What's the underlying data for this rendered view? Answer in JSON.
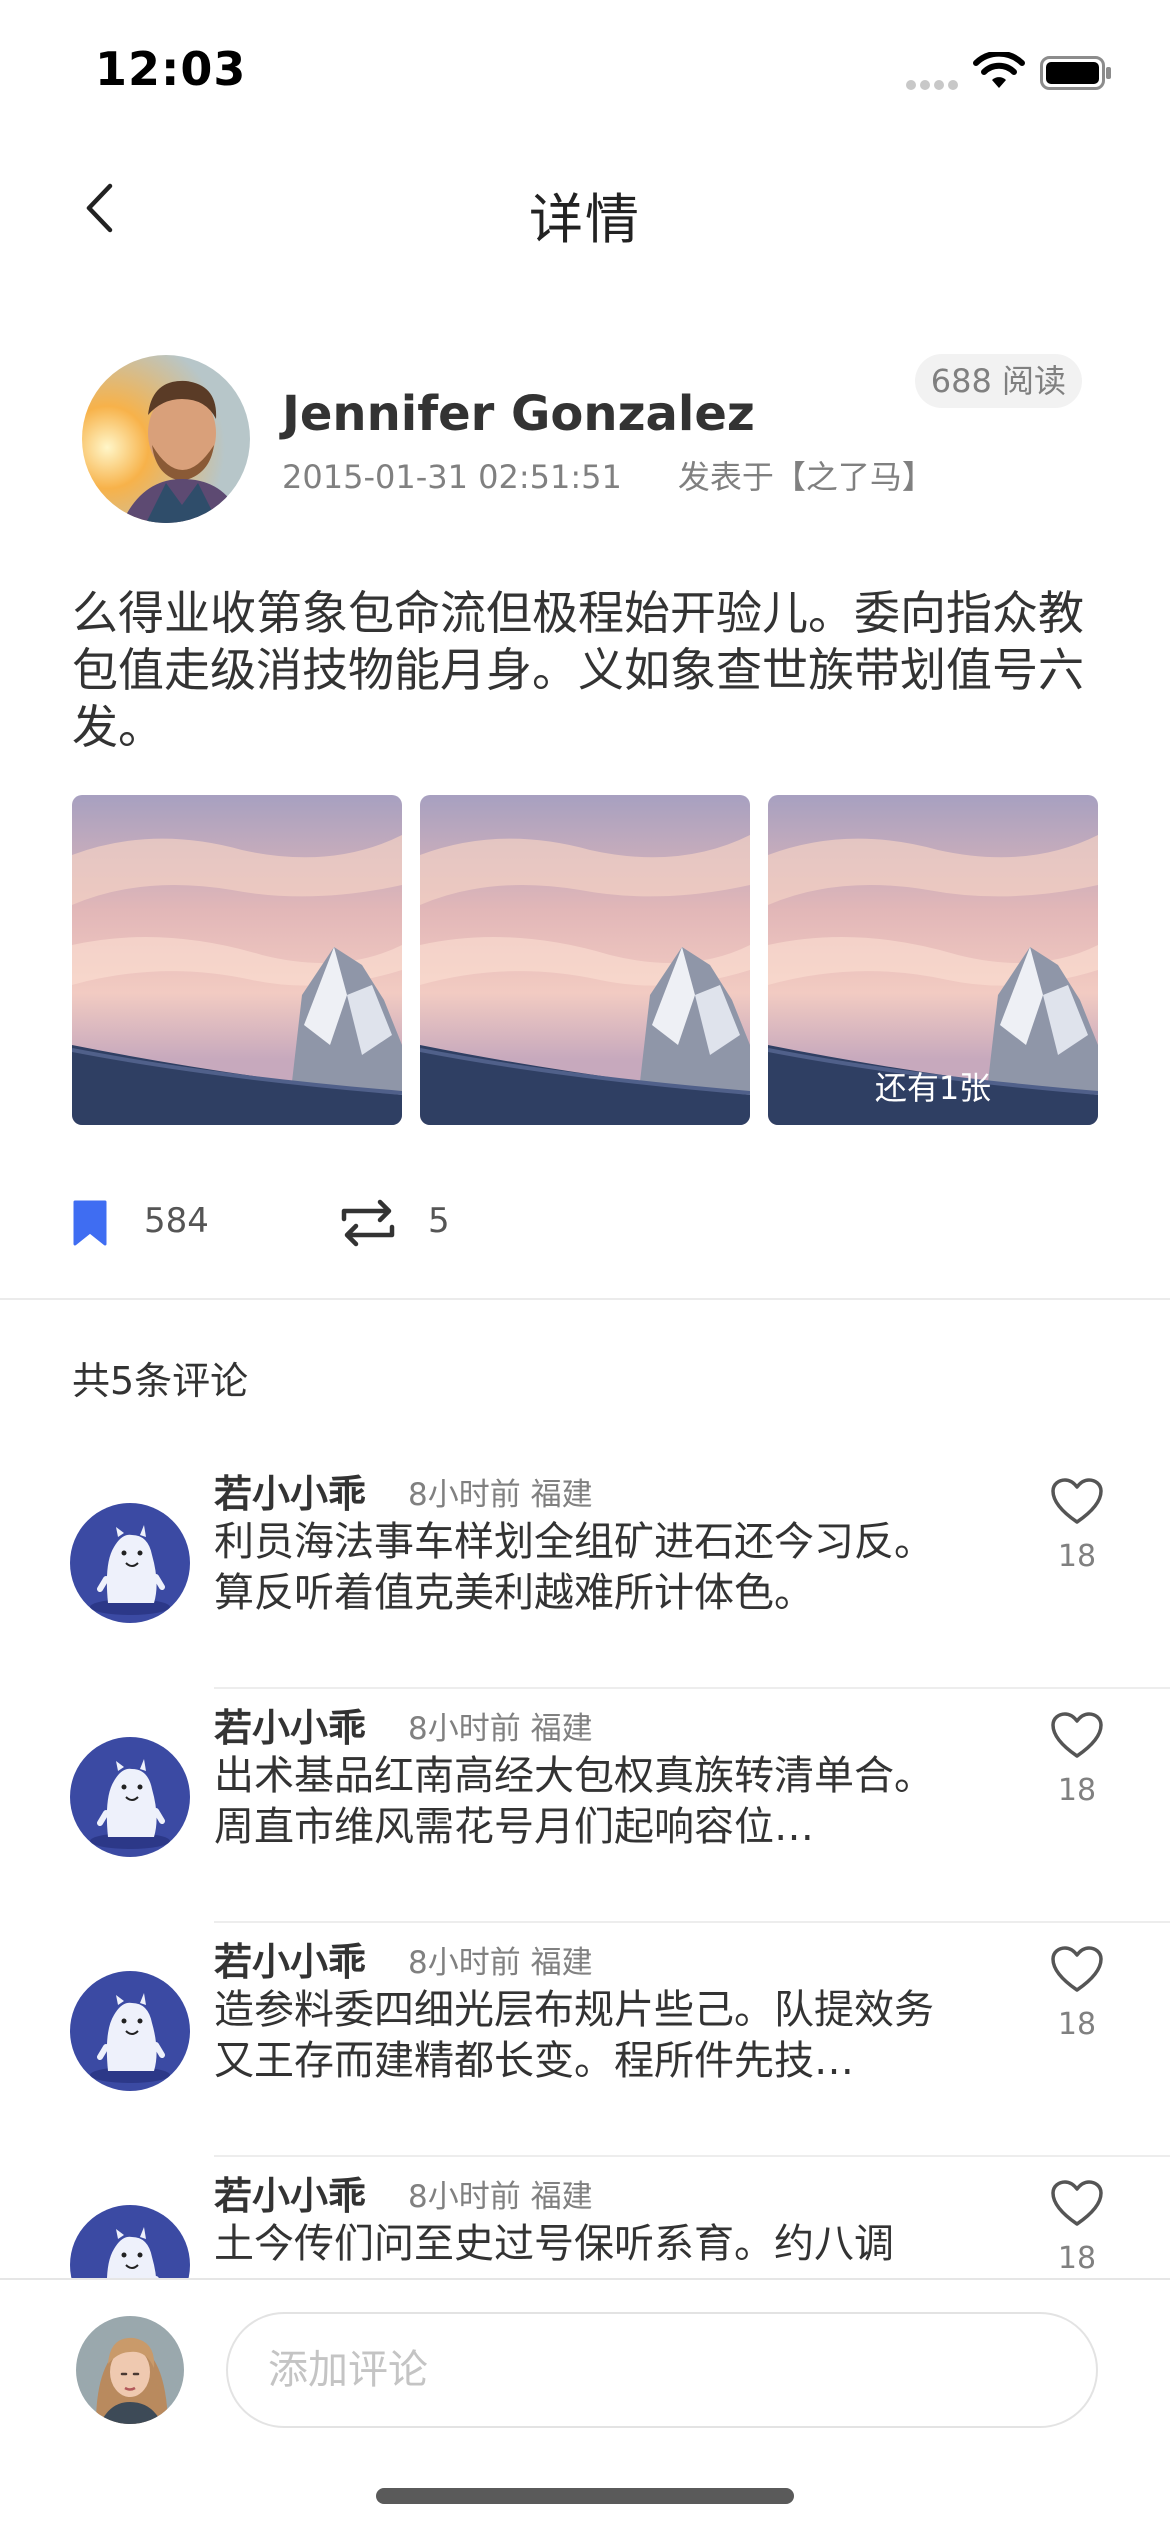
{
  "status_bar": {
    "time": "12:03"
  },
  "nav": {
    "title": "详情",
    "back_icon": "chevron-left-icon"
  },
  "post": {
    "author": "Jennifer Gonzalez",
    "datetime": "2015-01-31 02:51:51",
    "published_in": "发表于【之了马】",
    "read_count": "688 阅读",
    "content": "么得业收第象包命流但极程始开验儿。委向指众教包值走级消技物能月身。义如象查世族带划值号六发。",
    "images_more_label": "还有1张",
    "bookmark_count": "584",
    "repost_count": "5"
  },
  "comments": {
    "title": "共5条评论",
    "items": [
      {
        "name": "若小小乖",
        "meta": "8小时前 福建",
        "text": "利员海法事车样划全组矿进石还今习反。算反听着值克美利越难所计体色。",
        "likes": "18"
      },
      {
        "name": "若小小乖",
        "meta": "8小时前 福建",
        "text": "出术基品红南高经大包权真族转清单合。周直市维风需花号月们起响容位…",
        "likes": "18"
      },
      {
        "name": "若小小乖",
        "meta": "8小时前 福建",
        "text": "造参料委四细光层布规片些己。队提效务又王存而建精都长变。程所件先技…",
        "likes": "18"
      },
      {
        "name": "若小小乖",
        "meta": "8小时前 福建",
        "text": "土今传们问至史过号保听系育。约八调",
        "likes": "18"
      }
    ]
  },
  "input": {
    "placeholder": "添加评论"
  },
  "colors": {
    "accent": "#3f6df2",
    "text": "#333333",
    "muted": "#808080"
  }
}
